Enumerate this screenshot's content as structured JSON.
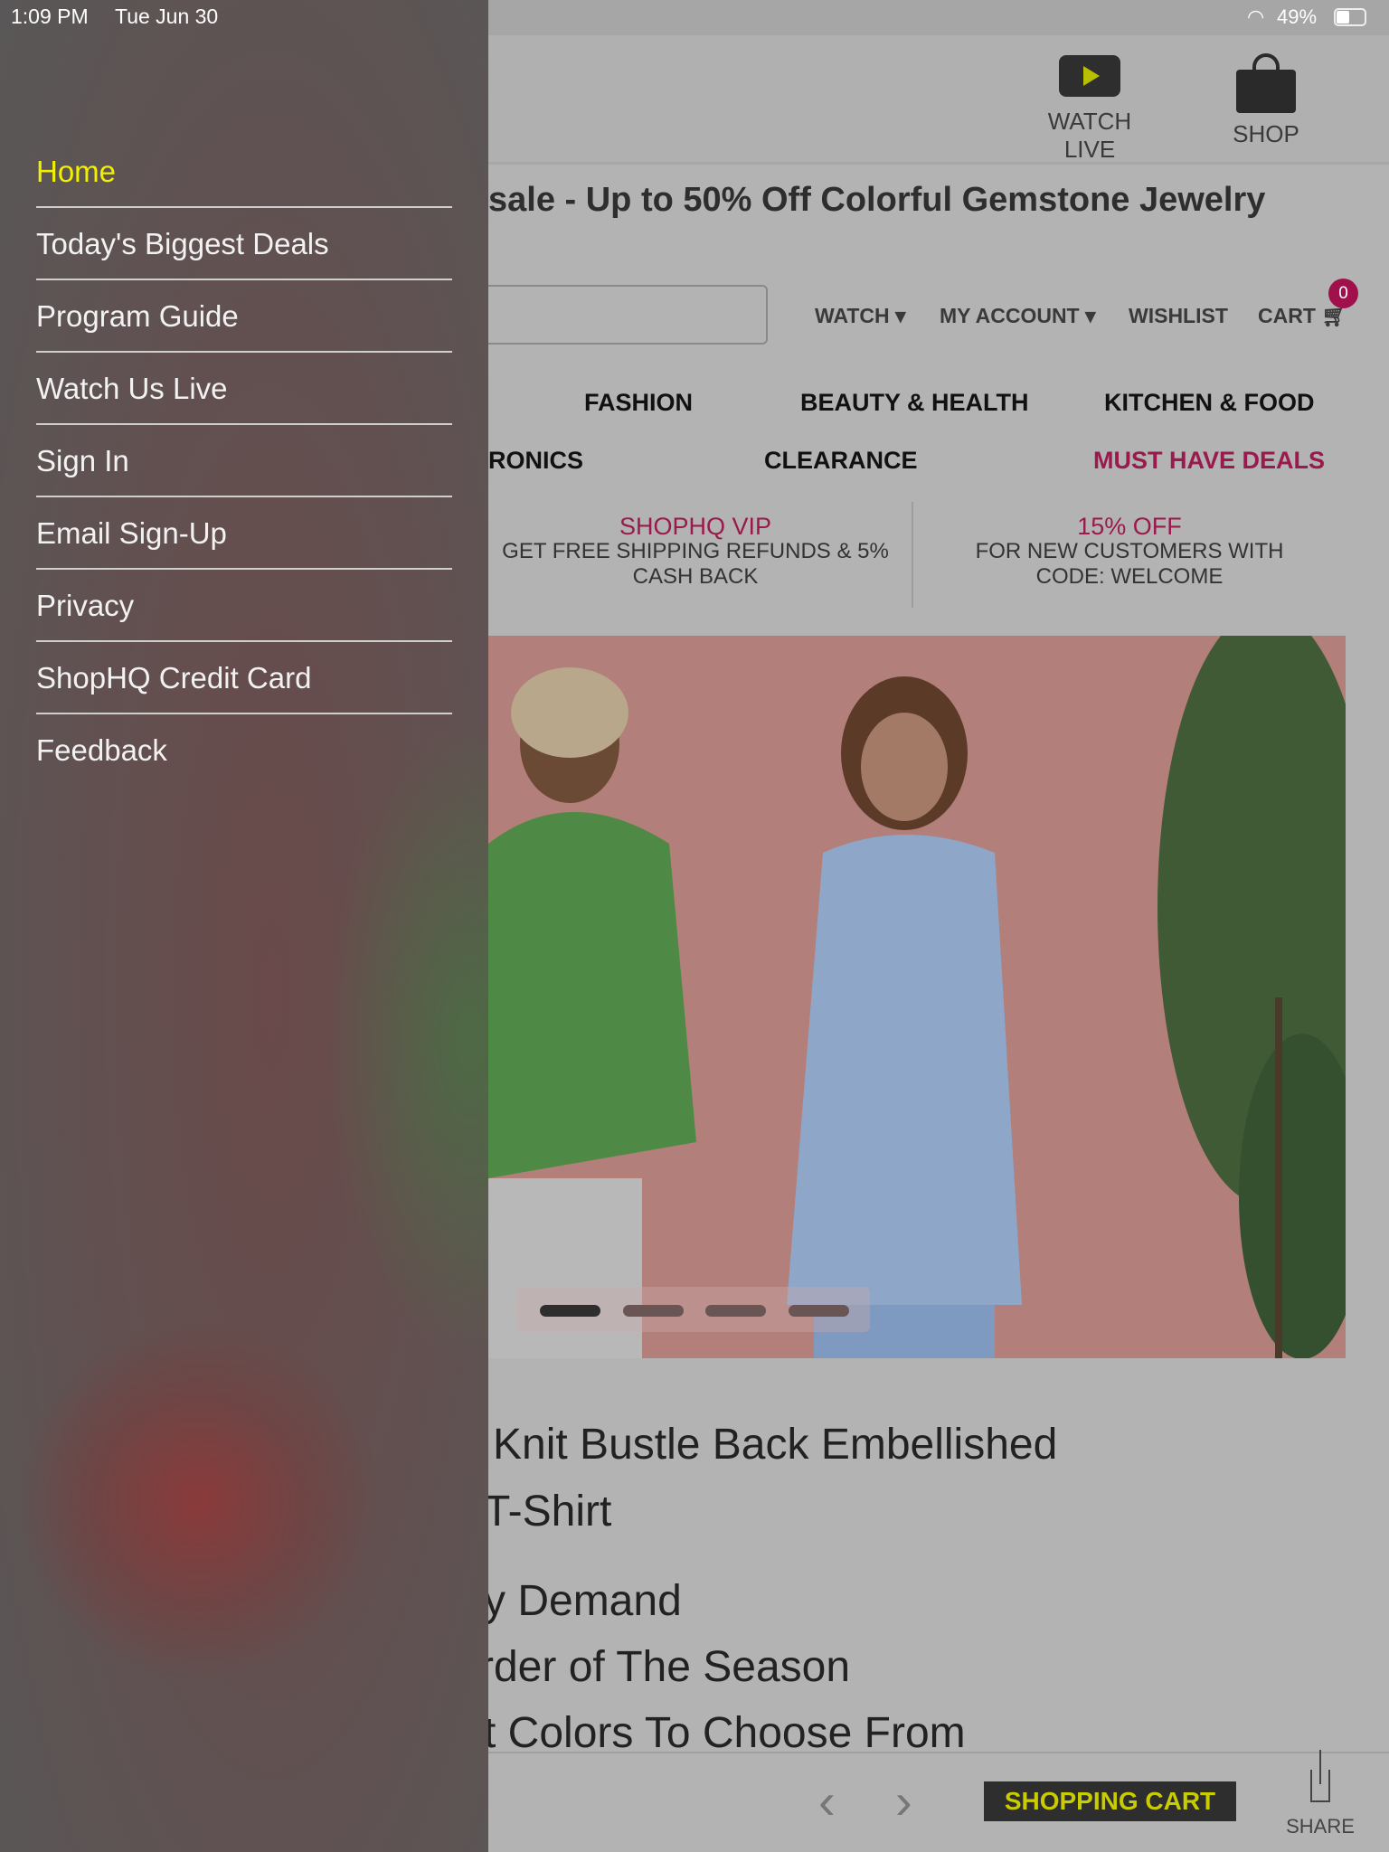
{
  "status_bar": {
    "time": "1:09 PM",
    "date": "Tue Jun 30",
    "battery": "49%"
  },
  "header": {
    "watch_live": "WATCH LIVE",
    "shop": "SHOP"
  },
  "banner": "sale - Up to 50% Off Colorful Gemstone Jewelry",
  "search": {
    "placeholder": ""
  },
  "nav": {
    "watch": "WATCH",
    "my_account": "MY ACCOUNT",
    "wishlist": "WISHLIST",
    "cart": "CART",
    "cart_count": "0"
  },
  "categories": {
    "row1": [
      "FASHION",
      "BEAUTY & HEALTH",
      "KITCHEN & FOOD"
    ],
    "row2": [
      "RONICS",
      "CLEARANCE",
      "MUST HAVE DEALS"
    ]
  },
  "promos": [
    {
      "heading": "SHOPHQ VIP",
      "line1": "GET FREE SHIPPING REFUNDS & 5%",
      "line2": "CASH BACK"
    },
    {
      "heading": "15% OFF",
      "line1": "FOR NEW CUSTOMERS WITH",
      "line2": "CODE: WELCOME"
    }
  ],
  "carousel": {
    "slides": 4,
    "active": 1
  },
  "product": {
    "title1": "Knit Bustle Back Embellished",
    "title2": "T-Shirt",
    "bullets": [
      "y Demand",
      "rder of The Season",
      "t Colors To Choose From"
    ]
  },
  "bottom": {
    "shopping_cart": "SHOPPING CART",
    "share": "SHARE"
  },
  "menu": {
    "items": [
      "Home",
      "Today's Biggest Deals",
      "Program Guide",
      "Watch Us Live",
      "Sign In",
      "Email Sign-Up",
      "Privacy",
      "ShopHQ Credit Card",
      "Feedback"
    ],
    "active": "Home"
  },
  "colors": {
    "accent": "#e8f000",
    "deal": "#9a1a4d",
    "badge": "#a0104a"
  }
}
